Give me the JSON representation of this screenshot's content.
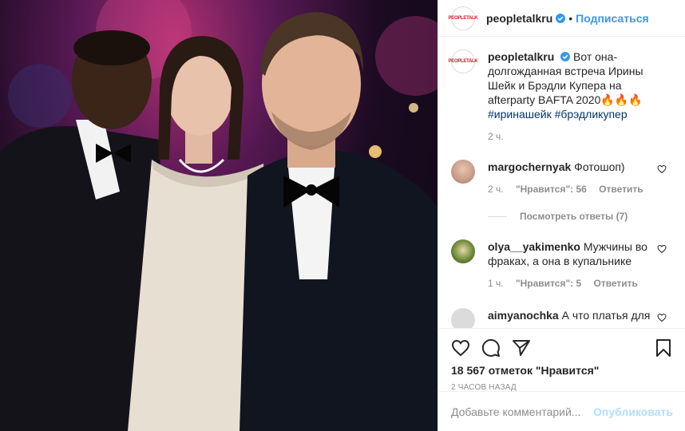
{
  "header": {
    "account_name": "peopletalkru",
    "avatar_logo": "PEOPLETALK",
    "separator": "•",
    "follow_label": "Подписаться"
  },
  "caption": {
    "username": "peopletalkru",
    "text": "Вот она-долгожданная встреча Ирины Шейк и Брэдли Купера на afterparty BAFTA 2020🔥🔥🔥",
    "hashtags": "#иринашейк #брэдликупер",
    "time": "2 ч."
  },
  "comments": [
    {
      "username": "margochernyak",
      "text": "Фотошоп)",
      "time": "2 ч.",
      "likes": "\"Нравится\": 56",
      "reply": "Ответить",
      "replies": "Посмотреть ответы (7)"
    },
    {
      "username": "olya__yakimenko",
      "text": "Мужчины во фраках, а она в купальнике",
      "time": "1 ч.",
      "likes": "\"Нравится\": 5",
      "reply": "Ответить"
    },
    {
      "username": "aimyanochka",
      "text": "А что платья для"
    }
  ],
  "actions": {
    "likes_count": "18 567 отметок \"Нравится\"",
    "posted_ago": "2 ЧАСОВ НАЗАД"
  },
  "add_comment": {
    "placeholder": "Добавьте комментарий...",
    "publish_label": "Опубликовать"
  },
  "colors": {
    "accent": "#3897f0",
    "verified": "#3897f0",
    "publish_disabled": "#b2dffc",
    "hashtag": "#00376b"
  },
  "icons": [
    "verified-icon",
    "heart-icon",
    "comment-icon",
    "share-icon",
    "bookmark-icon",
    "small-heart-icon"
  ]
}
